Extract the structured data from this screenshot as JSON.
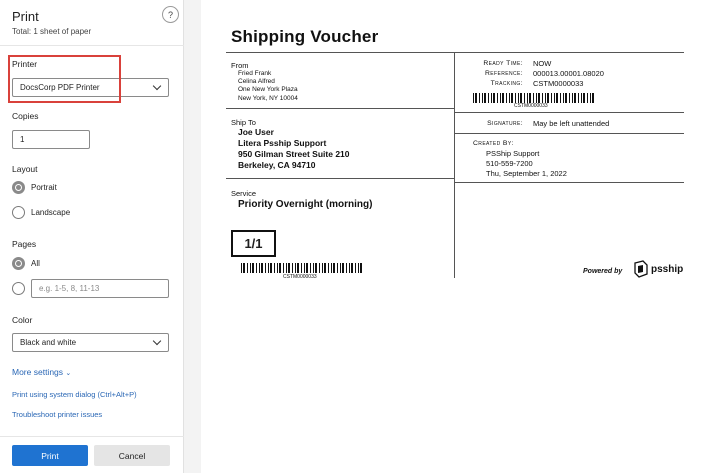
{
  "panel": {
    "title": "Print",
    "subtitle": "Total: 1 sheet of paper",
    "help": "?",
    "printer_label": "Printer",
    "printer_value": "DocsCorp PDF Printer",
    "copies_label": "Copies",
    "copies_value": "1",
    "layout_label": "Layout",
    "layout_options": [
      "Portrait",
      "Landscape"
    ],
    "pages_label": "Pages",
    "pages_all": "All",
    "pages_placeholder": "e.g. 1-5, 8, 11-13",
    "color_label": "Color",
    "color_value": "Black and white",
    "more_settings": "More settings",
    "system_dialog": "Print using system dialog (Ctrl+Alt+P)",
    "troubleshoot": "Troubleshoot printer issues",
    "print_btn": "Print",
    "cancel_btn": "Cancel"
  },
  "voucher": {
    "title": "Shipping Voucher",
    "from_label": "From",
    "from_lines": [
      "Fried Frank",
      "Celina Alfred",
      "One New York Plaza",
      "New York, NY 10004"
    ],
    "shipto_label": "Ship To",
    "shipto_lines": [
      "Joe User",
      "Litera Psship Support",
      "950 Gilman Street Suite 210",
      "Berkeley, CA 94710"
    ],
    "service_label": "Service",
    "service_value": "Priority Overnight (morning)",
    "page_box": "1/1",
    "barcode_text": "CSTM0000033",
    "ready_time_label": "Ready Time:",
    "ready_time_value": "NOW",
    "reference_label": "Reference:",
    "reference_value": "000013.00001.08020",
    "tracking_label": "Tracking:",
    "tracking_value": "CSTM0000033",
    "signature_label": "Signature:",
    "signature_value": "May be left unattended",
    "created_label": "Created By:",
    "created_lines": [
      "PSShip Support",
      "510-559-7200",
      "Thu, September 1, 2022"
    ],
    "powered_by": "Powered by",
    "logo_text": "psship"
  }
}
